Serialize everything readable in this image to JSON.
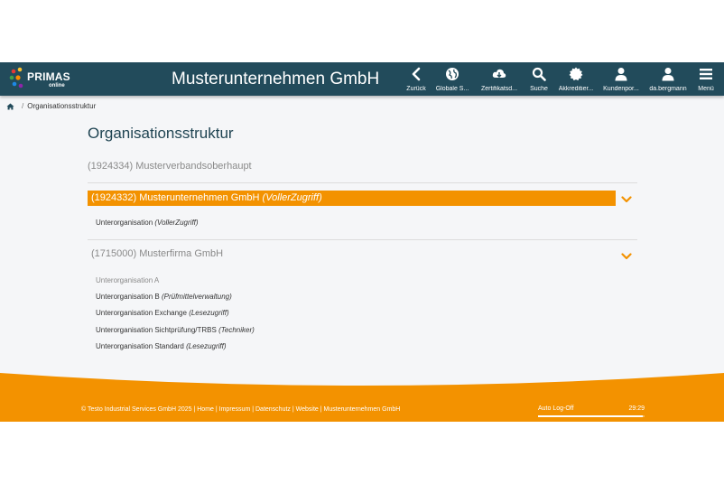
{
  "header": {
    "logo_text": "PRIMAS",
    "logo_sub": "online",
    "company_title": "Musterunternehmen GmbH",
    "nav": [
      {
        "label": "Zurück",
        "icon": "chevron-left-icon"
      },
      {
        "label": "Globale S...",
        "icon": "globe-icon"
      },
      {
        "label": "Zertifikatsd...",
        "icon": "cloud-download-icon"
      },
      {
        "label": "Suche",
        "icon": "search-icon"
      },
      {
        "label": "Akkreditier...",
        "icon": "certificate-icon"
      },
      {
        "label": "Kundenpor...",
        "icon": "user-icon"
      },
      {
        "label": "da.bergmann",
        "icon": "user-icon"
      },
      {
        "label": "Menü",
        "icon": "menu-icon"
      }
    ]
  },
  "breadcrumb": {
    "current": "Organisationsstruktur"
  },
  "page_title": "Organisationsstruktur",
  "parent_org": "(1924334) Musterverbandsoberhaupt",
  "org1": {
    "name": "(1924332) Musterunternehmen GmbH",
    "access": "(VollerZugriff)",
    "subs": [
      {
        "name": "Unterorganisation",
        "role": "(VollerZugriff)"
      }
    ]
  },
  "org2": {
    "name": "(1715000) Musterfirma GmbH",
    "subs": [
      {
        "name": "Unterorganisation A",
        "role": ""
      },
      {
        "name": "Unterorganisation B",
        "role": "(Prüfmittelverwaltung)"
      },
      {
        "name": "Unterorganisation Exchange",
        "role": "(Lesezugriff)"
      },
      {
        "name": "Unterorganisation Sichtprüfung/TRBS",
        "role": "(Techniker)"
      },
      {
        "name": "Unterorganisation Standard",
        "role": "(Lesezugriff)"
      }
    ]
  },
  "footer": {
    "copyright": "© Testo Industrial Services GmbH 2025",
    "links": [
      "Home",
      "Impressum",
      "Datenschutz",
      "Website",
      "Musterunternehmen GmbH"
    ],
    "autologoff_label": "Auto Log-Off",
    "autologoff_time": "29:29",
    "autologoff_progress": 0.98
  },
  "colors": {
    "header_bg": "#224b5b",
    "accent_orange": "#f39200",
    "title_color": "#1f4452"
  }
}
